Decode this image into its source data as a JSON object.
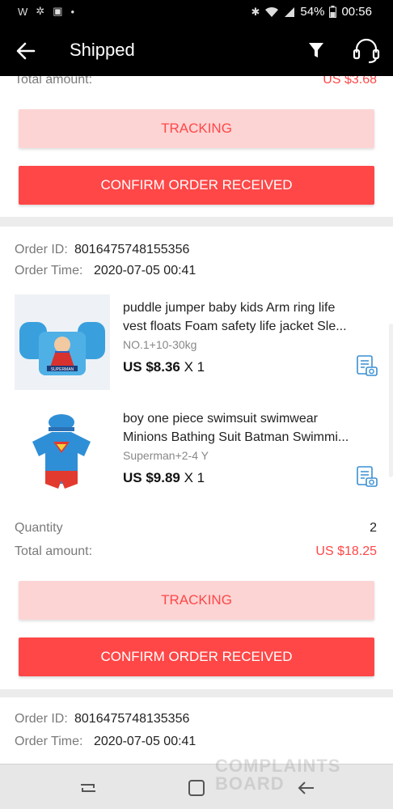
{
  "status_bar": {
    "battery": "54%",
    "time": "00:56"
  },
  "header": {
    "title": "Shipped"
  },
  "top_card": {
    "total_label": "Total amount:",
    "total_value": "US $3.68",
    "tracking_label": "TRACKING",
    "confirm_label": "CONFIRM ORDER RECEIVED"
  },
  "order1": {
    "id_label": "Order ID:",
    "id_value": "8016475748155356",
    "time_label": "Order Time:",
    "time_value": "2020-07-05 00:41",
    "items": [
      {
        "title_line1": "puddle jumper baby kids Arm ring life",
        "title_line2": "vest floats Foam safety life jacket Sle...",
        "sku": "NO.1+10-30kg",
        "price": "US $8.36",
        "qty": "X 1",
        "thumb_text": "SUPERMAN"
      },
      {
        "title_line1": "boy one piece swimsuit swimwear",
        "title_line2": "Minions Bathing Suit Batman Swimmi...",
        "sku": "Superman+2-4 Y",
        "price": "US $9.89",
        "qty": "X 1"
      }
    ],
    "quantity_label": "Quantity",
    "quantity_value": "2",
    "total_label": "Total amount:",
    "total_value": "US $18.25",
    "tracking_label": "TRACKING",
    "confirm_label": "CONFIRM ORDER RECEIVED"
  },
  "order2": {
    "id_label": "Order ID:",
    "id_value": "8016475748135356",
    "time_label": "Order Time:",
    "time_value": "2020-07-05 00:41"
  },
  "watermark": {
    "line1": "COMPLAINTS",
    "line2": "BOARD"
  },
  "colors": {
    "accent": "#ff4747",
    "tracking_bg": "#fdd4d4",
    "header_bg": "#000000"
  }
}
